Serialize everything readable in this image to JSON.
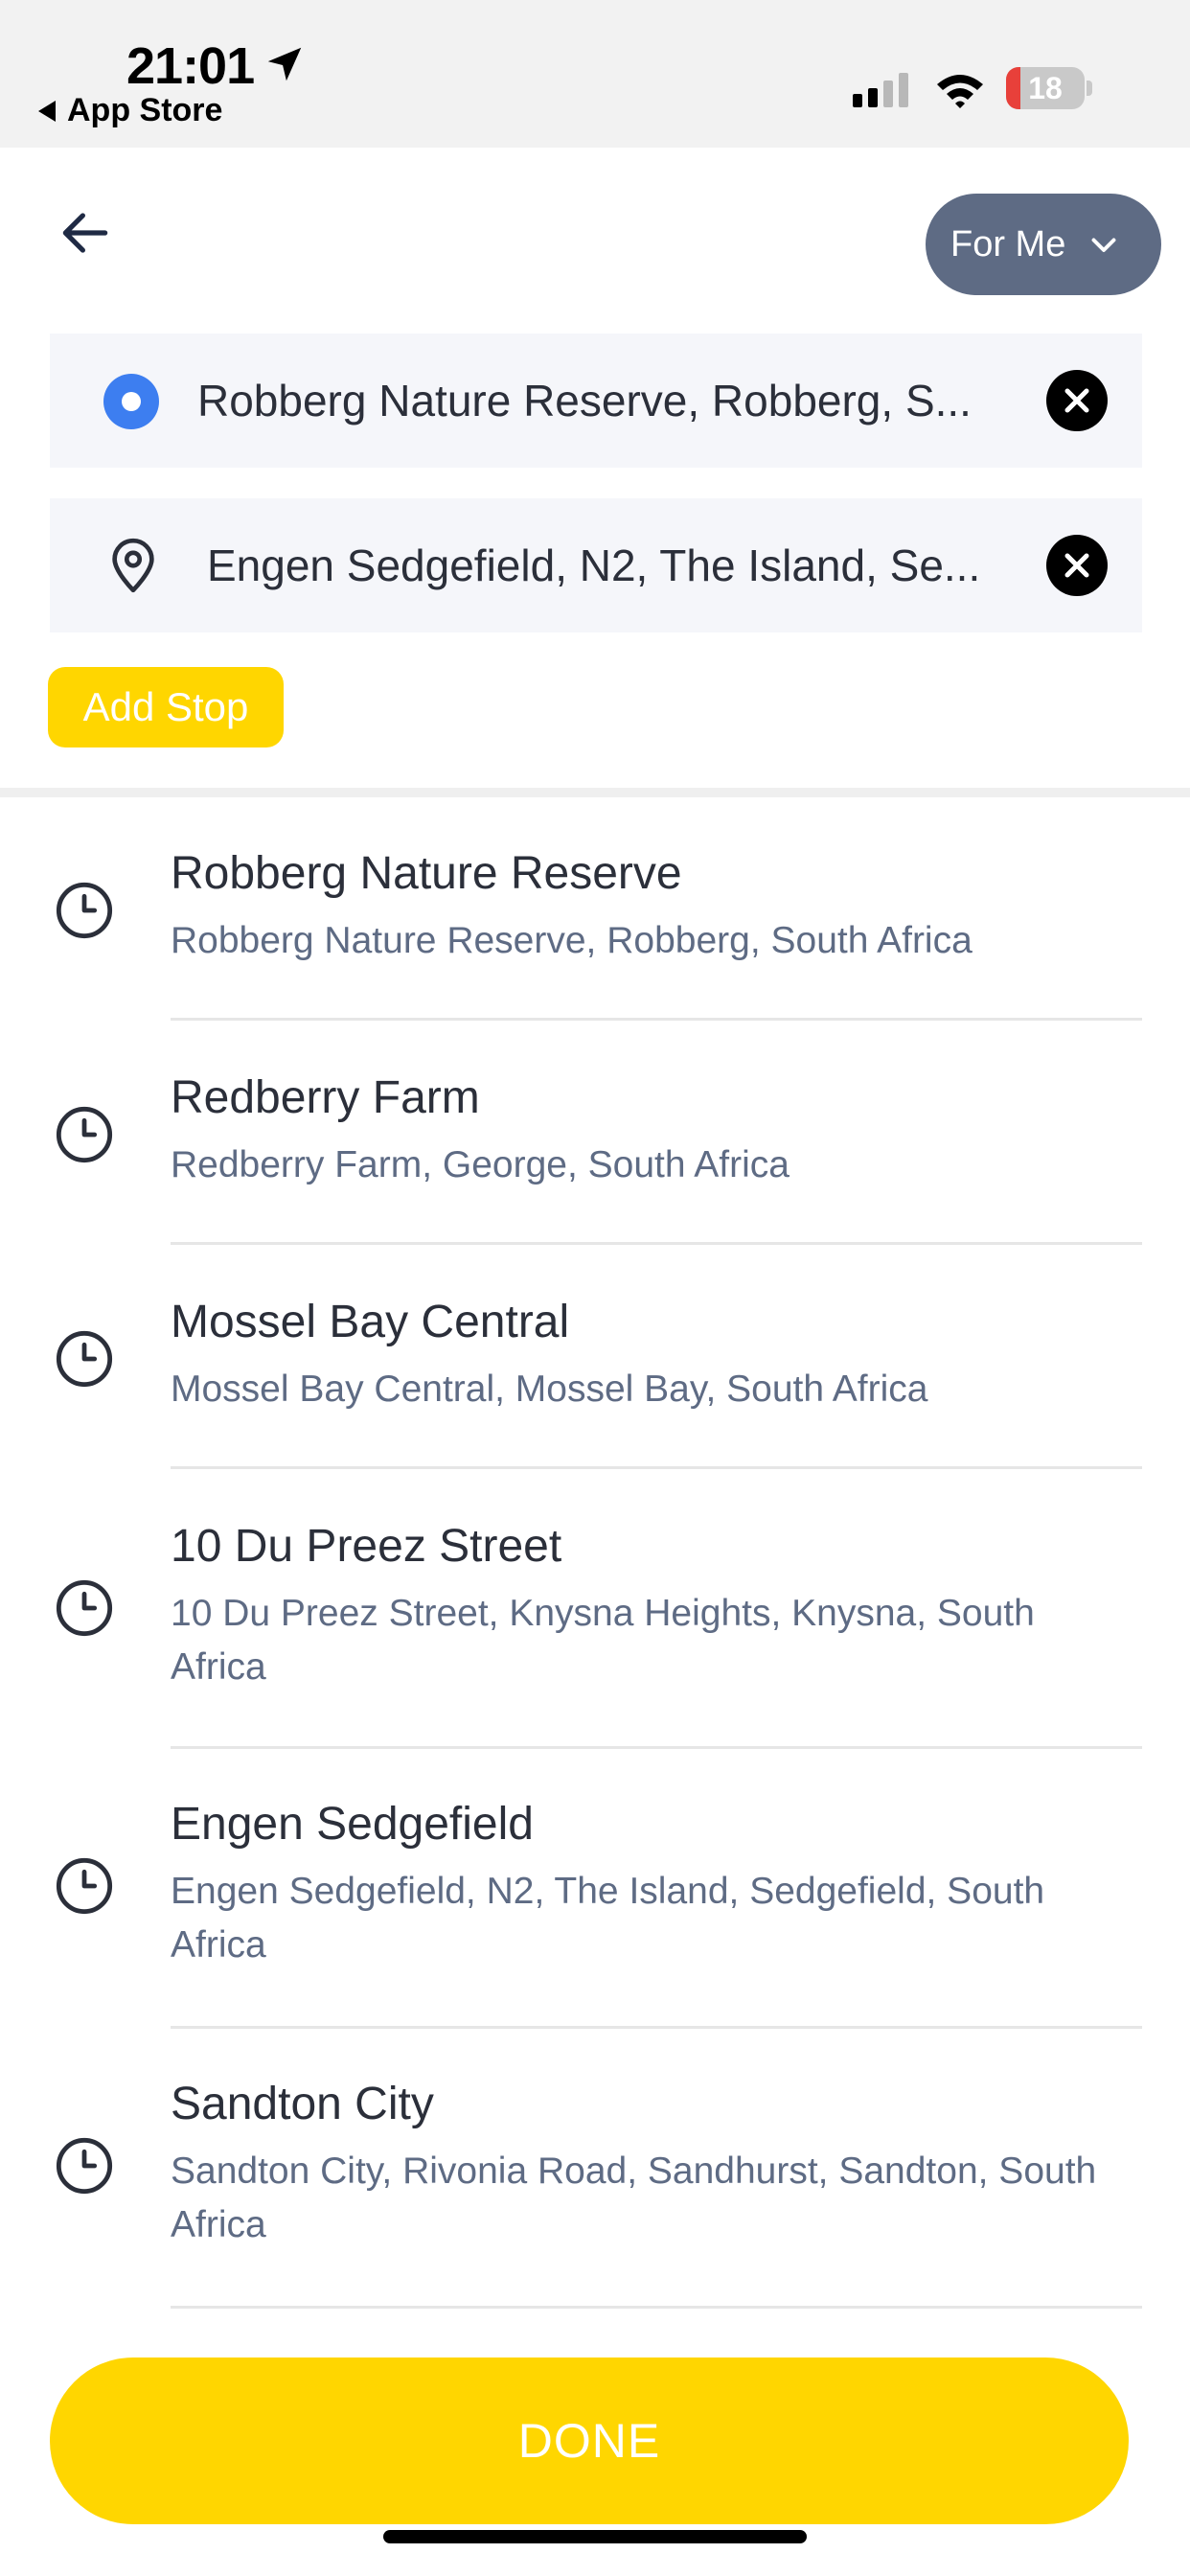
{
  "status_bar": {
    "time": "21:01",
    "back_app": "App Store",
    "battery_percent": "18",
    "battery_level": 0.18
  },
  "header": {
    "for_me_label": "For Me"
  },
  "route": {
    "origin": "Robberg Nature Reserve, Robberg, S...",
    "destination": "Engen Sedgefield, N2, The Island, Se...",
    "add_stop_label": "Add Stop"
  },
  "recent_places": [
    {
      "title": "Robberg Nature Reserve",
      "address": "Robberg Nature Reserve, Robberg, South Africa"
    },
    {
      "title": "Redberry Farm",
      "address": "Redberry Farm, George, South Africa"
    },
    {
      "title": "Mossel Bay Central",
      "address": "Mossel Bay Central, Mossel Bay, South Africa"
    },
    {
      "title": "10 Du Preez Street",
      "address": "10 Du Preez Street, Knysna Heights, Knysna, South Africa"
    },
    {
      "title": "Engen Sedgefield",
      "address": "Engen Sedgefield, N2, The Island, Sedgefield, South Africa"
    },
    {
      "title": "Sandton City",
      "address": "Sandton City, Rivonia Road, Sandhurst, Sandton, South Africa"
    }
  ],
  "footer": {
    "done_label": "DONE"
  },
  "colors": {
    "accent_yellow": "#ffd600",
    "slate": "#5e6b84",
    "origin_blue": "#3d7ef0"
  }
}
